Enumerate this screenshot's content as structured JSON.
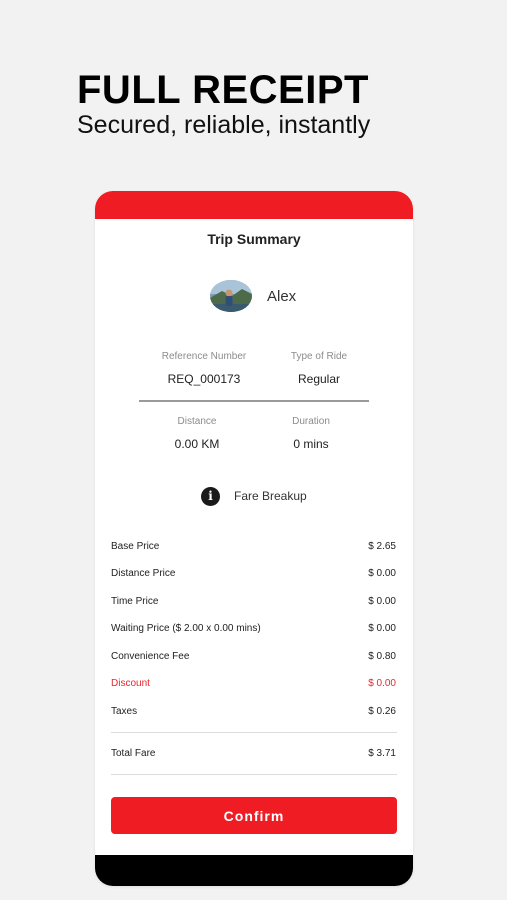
{
  "promo": {
    "title": "FULL RECEIPT",
    "subtitle": "Secured, reliable, instantly"
  },
  "screen": {
    "title": "Trip Summary"
  },
  "driver": {
    "name": "Alex"
  },
  "trip_info": {
    "reference_label": "Reference Number",
    "reference_value": "REQ_000173",
    "ride_type_label": "Type of Ride",
    "ride_type_value": "Regular",
    "distance_label": "Distance",
    "distance_value": "0.00 KM",
    "duration_label": "Duration",
    "duration_value": "0 mins"
  },
  "fare_breakup": {
    "label": "Fare Breakup",
    "rows": [
      {
        "label": "Base Price",
        "value": "$ 2.65"
      },
      {
        "label": "Distance Price",
        "value": "$ 0.00"
      },
      {
        "label": "Time Price",
        "value": "$ 0.00"
      },
      {
        "label": "Waiting Price ($ 2.00 x 0.00 mins)",
        "value": "$ 0.00"
      },
      {
        "label": "Convenience Fee",
        "value": "$ 0.80"
      },
      {
        "label": "Discount",
        "value": "$ 0.00"
      },
      {
        "label": "Taxes",
        "value": "$ 0.26"
      }
    ],
    "total_label": "Total Fare",
    "total_value": "$ 3.71"
  },
  "actions": {
    "confirm_label": "Confirm"
  },
  "colors": {
    "accent": "#ef1c23",
    "discount": "#e8262c"
  }
}
